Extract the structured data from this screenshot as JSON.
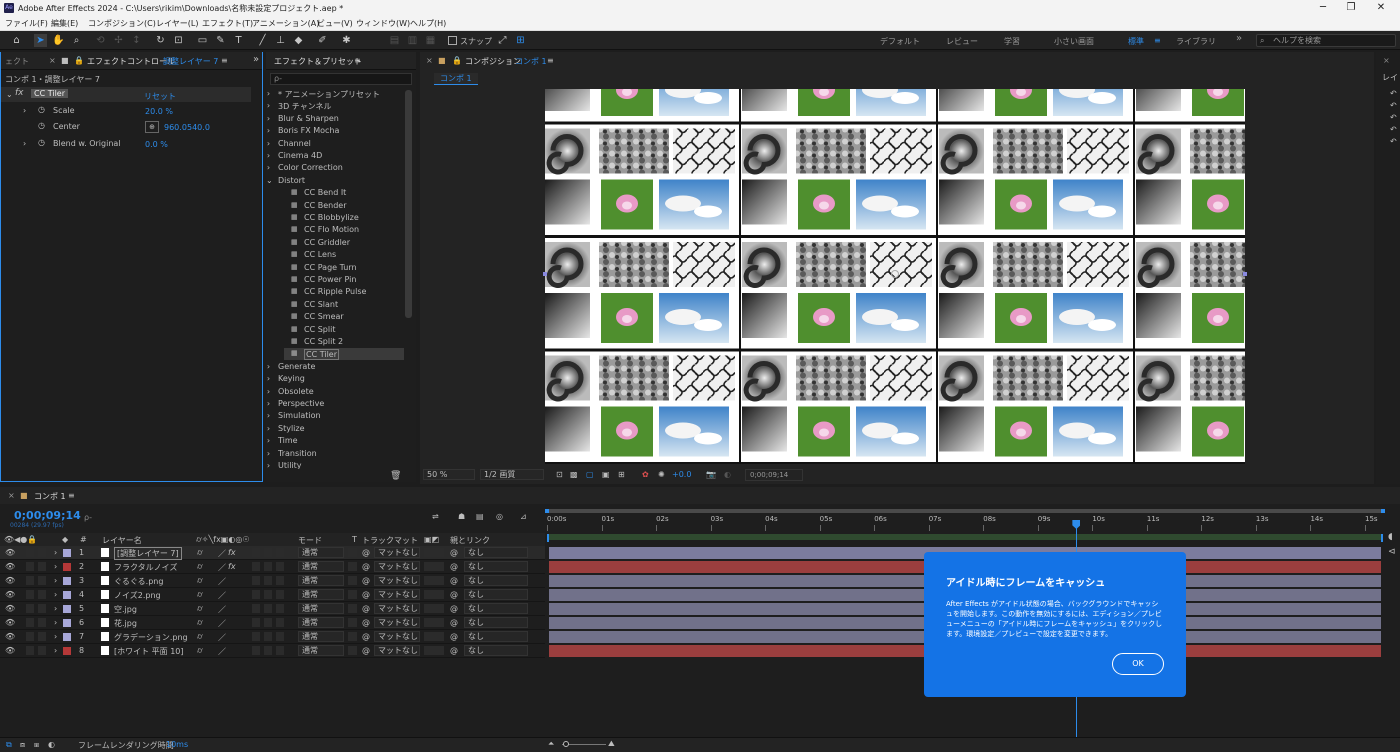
{
  "window": {
    "app_icon": "Ae",
    "title": "Adobe After Effects 2024 - C:\\Users\\rikim\\Downloads\\名称未設定プロジェクト.aep *"
  },
  "menu": [
    "ファイル(F)",
    "編集(E)",
    "コンポジション(C)",
    "レイヤー(L)",
    "エフェクト(T)",
    "アニメーション(A)",
    "ビュー(V)",
    "ウィンドウ(W)",
    "ヘルプ(H)"
  ],
  "toolbar": {
    "snap_label": "スナップ",
    "workspaces": [
      "デフォルト",
      "レビュー",
      "学習",
      "小さい画面",
      "標準",
      "ライブラリ"
    ],
    "active_workspace": "標準",
    "help_placeholder": "ヘルプを検索"
  },
  "effect_controls": {
    "tab_left": "ェクト",
    "tab_label": "エフェクトコントロール",
    "tab_target": "調整レイヤー 7",
    "breadcrumb": "コンポ 1・調整レイヤー 7",
    "effect_name": "CC Tiler",
    "reset": "リセット",
    "params": [
      {
        "name": "Scale",
        "value": "20.0 %"
      },
      {
        "name": "Center",
        "value_x": "960.0",
        "value_y": "540.0"
      },
      {
        "name": "Blend w. Original",
        "value": "0.0 %"
      }
    ]
  },
  "effects_presets": {
    "title": "エフェクト＆プリセット",
    "search_placeholder": "ρ-",
    "categories_top": [
      "* アニメーションプリセット",
      "3D チャンネル",
      "Blur & Sharpen",
      "Boris FX Mocha",
      "Channel",
      "Cinema 4D",
      "Color Correction",
      "Distort"
    ],
    "distort_items": [
      "CC Bend It",
      "CC Bender",
      "CC Blobbylize",
      "CC Flo Motion",
      "CC Griddler",
      "CC Lens",
      "CC Page Turn",
      "CC Power Pin",
      "CC Ripple Pulse",
      "CC Slant",
      "CC Smear",
      "CC Split",
      "CC Split 2",
      "CC Tiler"
    ],
    "categories_bottom": [
      "Generate",
      "Keying",
      "Obsolete",
      "Perspective",
      "Simulation",
      "Stylize",
      "Time",
      "Transition",
      "Utility"
    ],
    "selected": "CC Tiler"
  },
  "composition": {
    "panel_label": "コンポジション",
    "comp_name": "コンポ 1",
    "tab": "コンポ 1",
    "zoom": "50 %",
    "resolution": "1/2 画質",
    "exposure": "+0.0",
    "timecode": "0;00;09;14"
  },
  "right_strip": {
    "label": "レイ"
  },
  "timeline": {
    "tab": "コンポ 1",
    "timecode": "0;00;09;14",
    "frames": "00284 (29.97 fps)",
    "search_placeholder": "ρ-",
    "headers": {
      "num": "#",
      "layer_name": "レイヤー名",
      "mode": "モード",
      "t": "T",
      "trackmatte": "トラックマット",
      "parent": "親とリンク"
    },
    "ruler": [
      "0:00s",
      "01s",
      "02s",
      "03s",
      "04s",
      "05s",
      "06s",
      "07s",
      "08s",
      "09s",
      "10s",
      "11s",
      "12s",
      "13s",
      "14s",
      "15s"
    ],
    "playhead_fraction": 0.6317,
    "layers": [
      {
        "num": "1",
        "name": "[調整レイヤー 7]",
        "color": "#a7a7d8",
        "mode": "通常",
        "matte": "マットなし",
        "parent": "なし",
        "fx": true,
        "bar": "#7c7c9e"
      },
      {
        "num": "2",
        "name": "フラクタルノイズ",
        "color": "#b53838",
        "mode": "通常",
        "matte": "マットなし",
        "parent": "なし",
        "fx": true,
        "bar": "#9b3e3e"
      },
      {
        "num": "3",
        "name": "ぐるぐる.png",
        "color": "#a7a7d8",
        "mode": "通常",
        "matte": "マットなし",
        "parent": "なし",
        "fx": false,
        "bar": "#71718a"
      },
      {
        "num": "4",
        "name": "ノイズ2.png",
        "color": "#a7a7d8",
        "mode": "通常",
        "matte": "マットなし",
        "parent": "なし",
        "fx": false,
        "bar": "#71718a"
      },
      {
        "num": "5",
        "name": "空.jpg",
        "color": "#a7a7d8",
        "mode": "通常",
        "matte": "マットなし",
        "parent": "なし",
        "fx": false,
        "bar": "#71718a"
      },
      {
        "num": "6",
        "name": "花.jpg",
        "color": "#a7a7d8",
        "mode": "通常",
        "matte": "マットなし",
        "parent": "なし",
        "fx": false,
        "bar": "#71718a"
      },
      {
        "num": "7",
        "name": "グラデーション.png",
        "color": "#a7a7d8",
        "mode": "通常",
        "matte": "マットなし",
        "parent": "なし",
        "fx": false,
        "bar": "#71718a"
      },
      {
        "num": "8",
        "name": "[ホワイト 平面 10]",
        "color": "#b53838",
        "mode": "通常",
        "matte": "マットなし",
        "parent": "なし",
        "fx": false,
        "bar": "#9b3e3e"
      }
    ],
    "footer": {
      "label": "フレームレンダリング時間",
      "value": "10ms"
    }
  },
  "tooltip": {
    "title": "アイドル時にフレームをキャッシュ",
    "body": "After Effects がアイドル状態の場合、バックグラウンドでキャッシュを開始します。この動作を無効にするには、エディション／プレビューメニューの「アイドル時にフレームをキャッシュ」をクリックします。環境設定／プレビューで設定を変更できます。",
    "ok": "OK"
  },
  "colors": {
    "accent": "#2d8ceb",
    "tooltip_bg": "#1473e6",
    "work_area": "#3b8a3b"
  }
}
